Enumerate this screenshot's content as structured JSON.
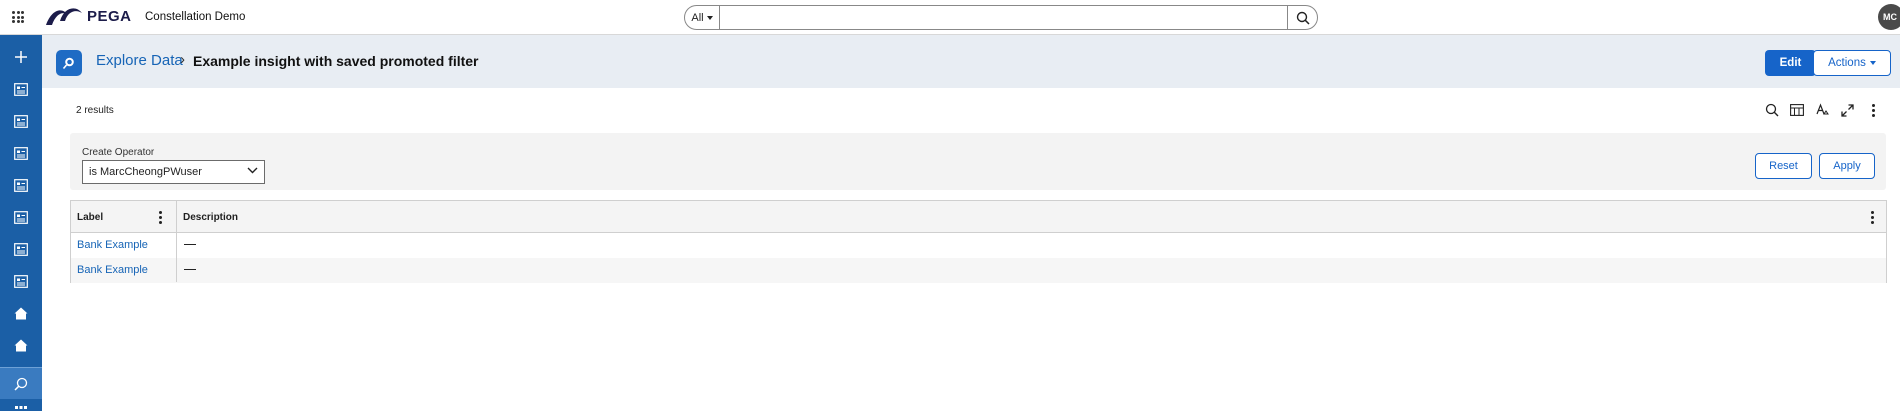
{
  "header": {
    "logo_text": "PEGA",
    "app_name": "Constellation Demo",
    "search": {
      "scope": "All",
      "value": "",
      "placeholder": ""
    },
    "avatar_initials": "MC"
  },
  "sidebar": {
    "items": [
      {
        "icon": "plus-icon"
      },
      {
        "icon": "list-icon"
      },
      {
        "icon": "list-icon"
      },
      {
        "icon": "list-icon"
      },
      {
        "icon": "list-icon"
      },
      {
        "icon": "list-icon"
      },
      {
        "icon": "list-icon"
      },
      {
        "icon": "list-icon"
      },
      {
        "icon": "home-icon"
      },
      {
        "icon": "home-icon"
      },
      {
        "icon": "explore-search-icon",
        "active": true
      }
    ]
  },
  "page": {
    "breadcrumb_link": "Explore Data",
    "breadcrumb_sep": "›",
    "title": "Example insight with saved promoted filter",
    "edit_label": "Edit",
    "actions_label": "Actions"
  },
  "results_count": "2 results",
  "filter": {
    "label": "Create Operator",
    "value": "is MarcCheongPWuser",
    "reset_label": "Reset",
    "apply_label": "Apply"
  },
  "table": {
    "columns": [
      "Label",
      "Description"
    ],
    "rows": [
      {
        "label": "Bank Example",
        "description": "—"
      },
      {
        "label": "Bank Example",
        "description": "—"
      }
    ]
  },
  "colors": {
    "brand_blue": "#1664c9",
    "nav_blue": "#1b5fa6",
    "header_bg": "#e8edf3"
  }
}
